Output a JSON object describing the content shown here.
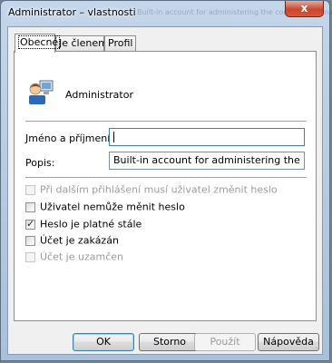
{
  "window": {
    "title": "Administrator – vlastnosti",
    "ghost_text": "Built-in account for administering the computer/domain",
    "close_label": "x"
  },
  "tabs": [
    {
      "label": "Obecné",
      "active": true
    },
    {
      "label": "Je členem",
      "active": false
    },
    {
      "label": "Profil",
      "active": false
    }
  ],
  "general": {
    "user_icon": "user-icon",
    "username": "Administrator",
    "full_name_label": "Jméno a příjmení:",
    "full_name_value": "",
    "description_label": "Popis:",
    "description_value": "Built-in account for administering the"
  },
  "checkboxes": [
    {
      "label": "Při dalším přihlášení musí uživatel změnit heslo",
      "checked": false,
      "enabled": false
    },
    {
      "label": "Uživatel nemůže měnit heslo",
      "checked": false,
      "enabled": true
    },
    {
      "label": "Heslo je platné stále",
      "checked": true,
      "enabled": true
    },
    {
      "label": "Účet je zakázán",
      "checked": false,
      "enabled": true
    },
    {
      "label": "Účet je uzamčen",
      "checked": false,
      "enabled": false
    }
  ],
  "buttons": {
    "ok": "OK",
    "cancel": "Storno",
    "apply": "Použít",
    "help": "Nápověda"
  }
}
